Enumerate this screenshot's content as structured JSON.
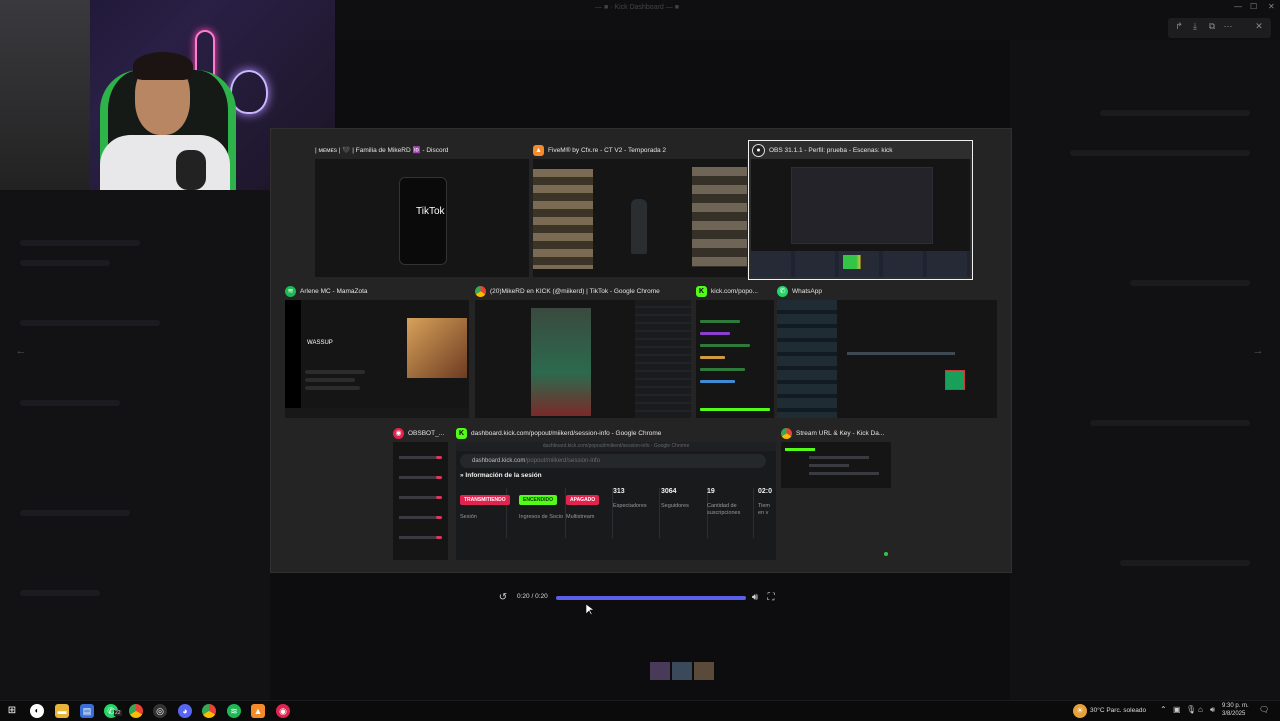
{
  "colors": {
    "accent": "#5b5fe8",
    "kick_green": "#53fc18",
    "discord": "#5865f2",
    "spotify": "#1db954",
    "whatsapp": "#25d366"
  },
  "background": {
    "title": "— ■ · Kick Dashboard — ■"
  },
  "switcher": {
    "windows": [
      {
        "id": "discord",
        "title": "| ᴍᴇᴍᴇs | 🖤 | Familia de MikeRD 🆔 - Discord",
        "icon": "discord-icon",
        "thumb_text": "TikTok"
      },
      {
        "id": "fivem",
        "title": "FiveM® by Cfx.re - CT V2 - Temporada 2",
        "icon": "fivem-icon"
      },
      {
        "id": "obs",
        "title": "OBS 31.1.1 - Perfil: prueba - Escenas: kick",
        "icon": "obs-icon",
        "selected": true
      },
      {
        "id": "spotify",
        "title": "Arlene MC - MamaZota",
        "icon": "spotify-icon",
        "thumb_text": "WASSUP"
      },
      {
        "id": "kick-chrome",
        "title": "(20)MikeRD en KICK (@miikerd) | TikTok - Google Chrome",
        "icon": "chrome-icon"
      },
      {
        "id": "kick-popout",
        "title": "kick.com/popo...",
        "icon": "kick-icon"
      },
      {
        "id": "whatsapp",
        "title": "WhatsApp",
        "icon": "whatsapp-icon"
      },
      {
        "id": "obsbot",
        "title": "OBSBOT_...",
        "icon": "obsbot-icon"
      },
      {
        "id": "kick-dash",
        "title": "dashboard.kick.com/popout/miikerd/session-info - Google Chrome",
        "icon": "kick-icon"
      },
      {
        "id": "stream-key",
        "title": "Stream URL & Key - Kick Da...",
        "icon": "chrome-icon"
      }
    ]
  },
  "dashboard": {
    "window_title": "dashboard.kick.com/popout/miikerd/session-info - Google Chrome",
    "url_host": "dashboard.kick.com",
    "url_path": "/popout/miikerd/session-info",
    "heading": "Información de la sesión",
    "stats": [
      {
        "badge": "TRANSMITIENDO",
        "badge_color": "#e3234f",
        "label": "Sesión"
      },
      {
        "badge": "ENCENDIDO",
        "badge_color": "#53fc18",
        "label": "Ingresos de Socio"
      },
      {
        "badge": "APAGADO",
        "badge_color": "#e3234f",
        "label": "Multistream"
      },
      {
        "value": "313",
        "label": "Espectadores"
      },
      {
        "value": "3064",
        "label": "Seguidores"
      },
      {
        "value": "19",
        "label": "Cantidad de suscripciones"
      },
      {
        "value": "02:0",
        "label": "Tiem en v"
      }
    ]
  },
  "player": {
    "time": "0:20 / 0:20",
    "progress": 1.0
  },
  "taskbar": {
    "whatsapp_badge": "22",
    "weather": "30°C  Parc. soleado",
    "time": "9:30 p. m.",
    "date": "3/8/2025"
  }
}
